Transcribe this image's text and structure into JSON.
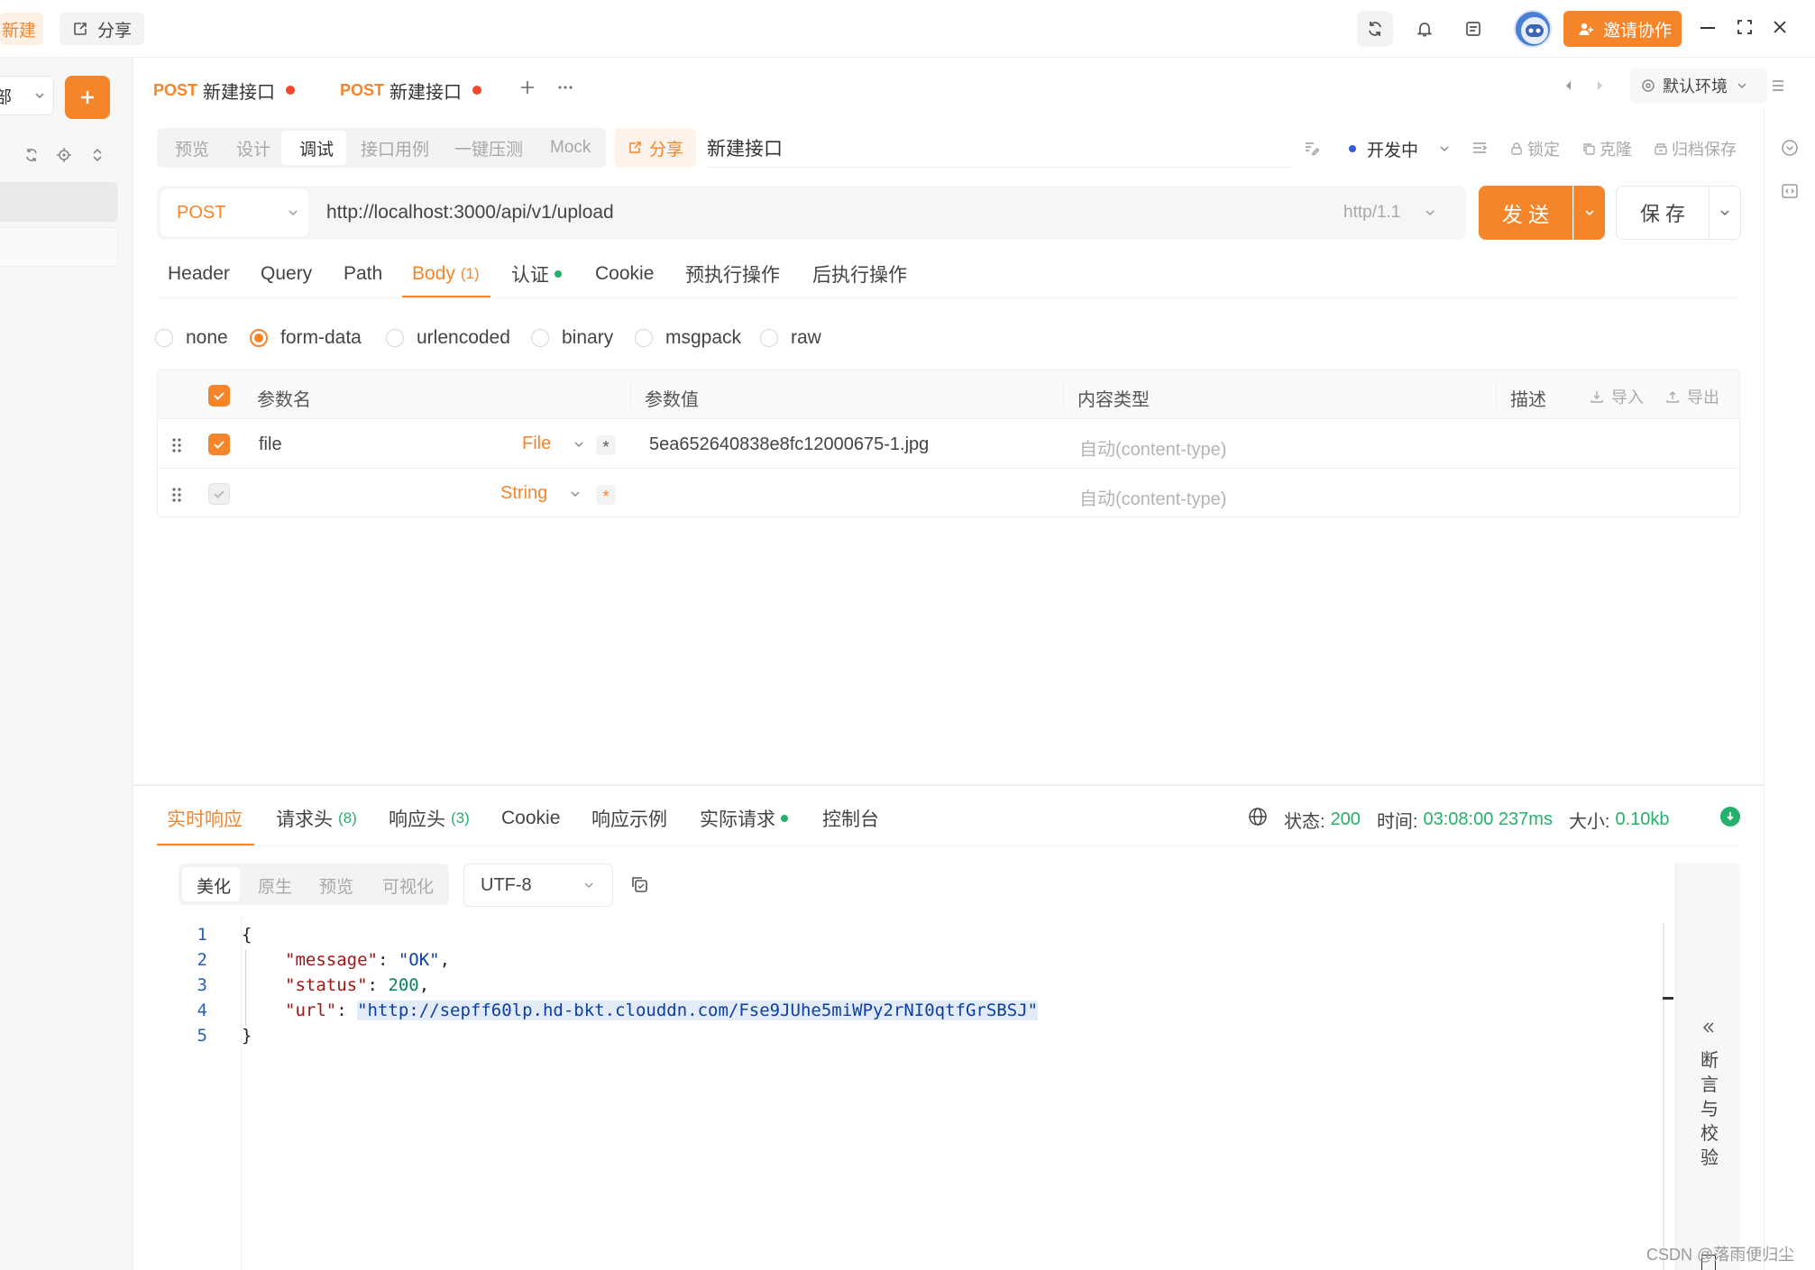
{
  "topbar": {
    "new_label": "新建",
    "share_label": "分享",
    "invite_label": "邀请协作"
  },
  "sidebar": {
    "scope_label": "部"
  },
  "tabs": [
    {
      "method": "POST",
      "name": "新建接口"
    },
    {
      "method": "POST",
      "name": "新建接口"
    }
  ],
  "env": {
    "label": "默认环境"
  },
  "subtoolbar": {
    "modes": [
      "预览",
      "设计",
      "调试",
      "接口用例",
      "一键压测",
      "Mock"
    ],
    "active_mode": "调试",
    "share_label": "分享",
    "api_name": "新建接口",
    "status_label": "开发中",
    "lock_label": "锁定",
    "clone_label": "克隆",
    "archive_label": "归档保存"
  },
  "request": {
    "method": "POST",
    "url": "http://localhost:3000/api/v1/upload",
    "protocol": "http/1.1",
    "send_label": "发 送",
    "save_label": "保 存"
  },
  "param_tabs": [
    "Header",
    "Query",
    "Path",
    "Body",
    "认证",
    "Cookie",
    "预执行操作",
    "后执行操作"
  ],
  "body_count": "(1)",
  "body_types": [
    "none",
    "form-data",
    "urlencoded",
    "binary",
    "msgpack",
    "raw"
  ],
  "selected_body_type": "form-data",
  "table": {
    "headers": [
      "参数名",
      "参数值",
      "内容类型",
      "描述"
    ],
    "import_label": "导入",
    "export_label": "导出",
    "rows": [
      {
        "name": "file",
        "type": "File",
        "value": "5ea652640838e8fc12000675-1.jpg",
        "content_type": "自动(content-type)"
      },
      {
        "name": "",
        "type": "String",
        "value": "",
        "content_type": "自动(content-type)"
      }
    ]
  },
  "response": {
    "tabs": [
      "实时响应",
      "请求头",
      "响应头",
      "Cookie",
      "响应示例",
      "实际请求",
      "控制台"
    ],
    "req_header_count": "(8)",
    "resp_header_count": "(3)",
    "status_label": "状态:",
    "status_value": "200",
    "time_label": "时间:",
    "time_value": "03:08:00 237ms",
    "size_label": "大小:",
    "size_value": "0.10kb",
    "view_modes": [
      "美化",
      "原生",
      "预览",
      "可视化"
    ],
    "encoding": "UTF-8",
    "line_numbers": [
      "1",
      "2",
      "3",
      "4",
      "5"
    ],
    "json": {
      "open": "{",
      "k1": "\"message\"",
      "v1": "\"OK\"",
      "k2": "\"status\"",
      "v2": "200",
      "k3": "\"url\"",
      "v3": "\"http://sepff60lp.hd-bkt.clouddn.com/Fse9JUhe5miWPy2rNI0qtfGrSBSJ\"",
      "close": "}"
    },
    "assert_panel_label": "断言与校验"
  },
  "watermark": "CSDN @落雨便归尘",
  "colors": {
    "accent": "#f5852a",
    "success": "#26b06d",
    "dirty_dot": "#f5452a"
  }
}
